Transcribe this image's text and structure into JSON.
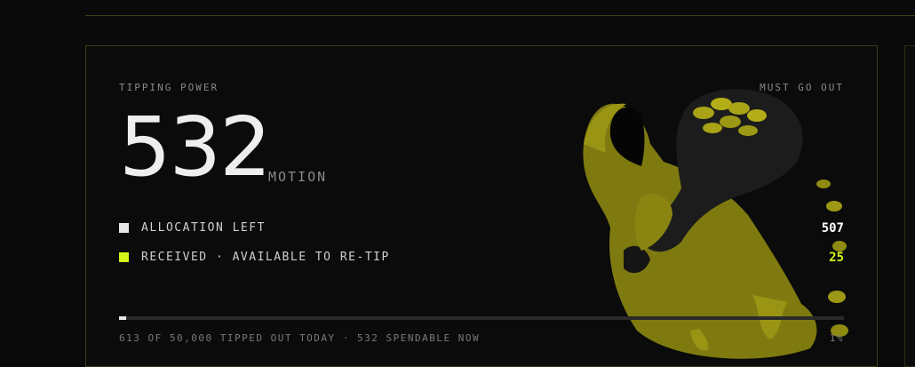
{
  "card": {
    "eyebrow_left": "TIPPING POWER",
    "eyebrow_right": "MUST GO OUT",
    "amount": "532",
    "unit": "MOTION"
  },
  "rows": [
    {
      "label": "ALLOCATION LEFT",
      "value": "507",
      "swatch_color": "#e8e8e8",
      "value_color": "#ffffff"
    },
    {
      "label": "RECEIVED · AVAILABLE TO RE-TIP",
      "value": "25",
      "swatch_color": "#d4f51a",
      "value_color": "#d4f51a"
    }
  ],
  "progress": {
    "fraction": 0.01
  },
  "footer": {
    "text": "613 OF 50,000 TIPPED OUT TODAY · 532 SPENDABLE NOW",
    "percent": "1%"
  },
  "colors": {
    "accent": "#d4f51a",
    "mascot": "#8f8a12",
    "bag": "#1c1c1c"
  },
  "icons": {
    "mascot": "hooded-figure-with-coin-bag"
  }
}
